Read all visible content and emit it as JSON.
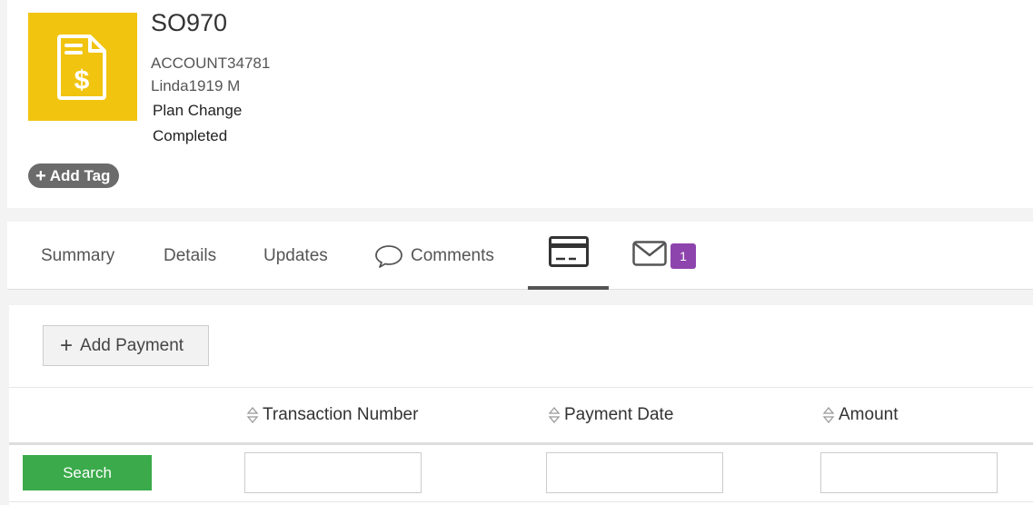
{
  "record": {
    "id": "SO970",
    "account": "ACCOUNT34781",
    "contact": "Linda1919 M",
    "type": "Plan Change",
    "status": "Completed",
    "icon": "invoice-dollar-icon",
    "icon_color": "#f1c40f"
  },
  "tags": {
    "add_label": "Add Tag"
  },
  "tabs": [
    {
      "label": "Summary"
    },
    {
      "label": "Details"
    },
    {
      "label": "Updates"
    },
    {
      "label": "Comments",
      "icon": "comment-bubble-icon"
    },
    {
      "label": "",
      "icon": "credit-card-icon",
      "active": true
    },
    {
      "label": "",
      "icon": "envelope-icon",
      "badge": "1"
    }
  ],
  "payments": {
    "add_label": "Add Payment",
    "search_label": "Search",
    "columns": [
      {
        "label": "Transaction Number"
      },
      {
        "label": "Payment Date"
      },
      {
        "label": "Amount"
      }
    ]
  },
  "colors": {
    "badge": "#8e44ad",
    "search": "#3aaa4a",
    "tag": "#6b6b6b"
  }
}
